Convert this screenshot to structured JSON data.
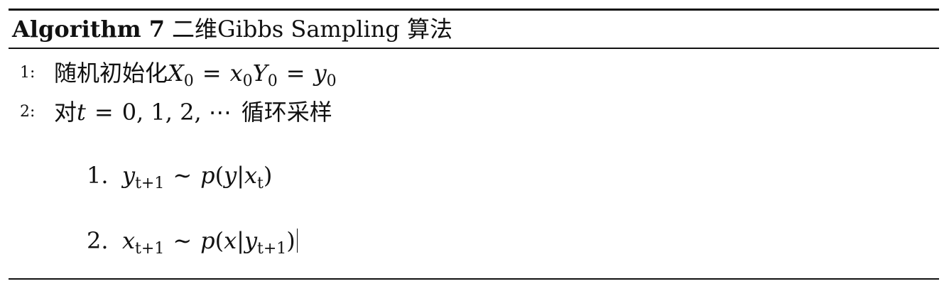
{
  "algorithm": {
    "label": "Algorithm 7",
    "name": "二维Gibbs Sampling 算法"
  },
  "steps": [
    {
      "num": "1:",
      "prefix": "随机初始化",
      "math": {
        "X": "X",
        "X_sub": "0",
        "eq1": "=",
        "x": "x",
        "x_sub": "0",
        "Y": "Y",
        "Y_sub": "0",
        "eq2": "=",
        "y": "y",
        "y_sub": "0"
      }
    },
    {
      "num": "2:",
      "prefix": "对",
      "math": {
        "t": "t",
        "eq": "=",
        "seq": "0, 1, 2, ⋯"
      },
      "suffix": "循环采样"
    }
  ],
  "substeps": [
    {
      "num": "1.",
      "lhs": "y",
      "lhs_sub": "t+1",
      "tilde": "∼",
      "p": "p",
      "open": "(",
      "var": "y",
      "bar": "|",
      "given": "x",
      "given_sub": "t",
      "close": ")"
    },
    {
      "num": "2.",
      "lhs": "x",
      "lhs_sub": "t+1",
      "tilde": "∼",
      "p": "p",
      "open": "(",
      "var": "x",
      "bar": "|",
      "given": "y",
      "given_sub": "t+1",
      "close": ")"
    }
  ]
}
